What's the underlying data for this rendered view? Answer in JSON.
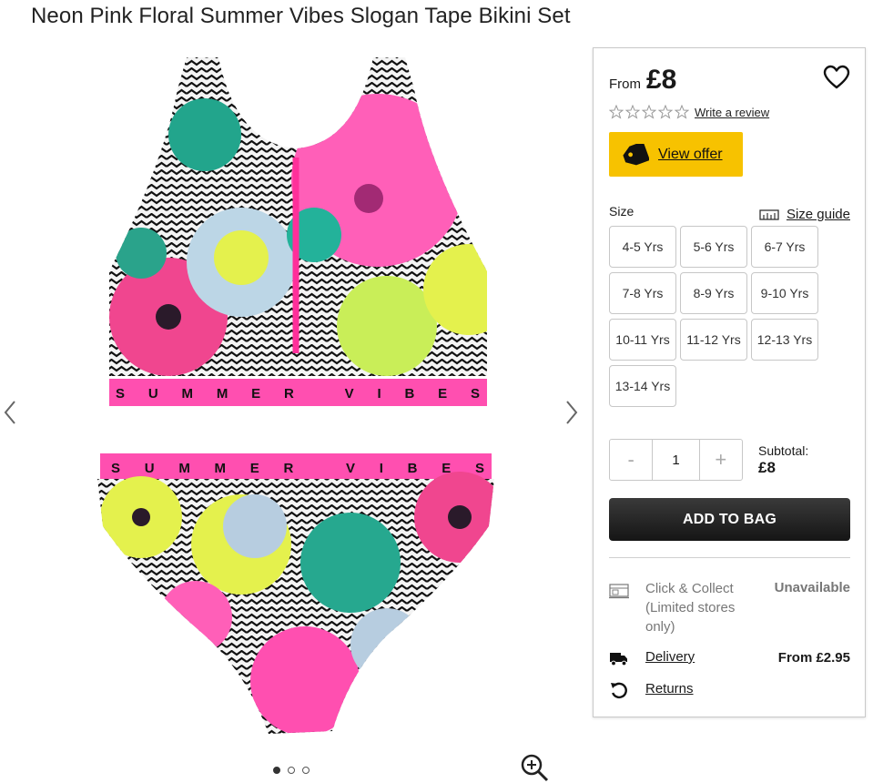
{
  "product": {
    "title": "Neon Pink Floral Summer Vibes Slogan Tape Bikini Set",
    "image_tape_text": "SUMMER VIBES"
  },
  "gallery": {
    "icons": {
      "prev": "chevron-left-icon",
      "next": "chevron-right-icon",
      "zoom": "zoom-in-icon"
    },
    "dots_count": 3,
    "active_dot": 1
  },
  "pricing": {
    "from_label": "From",
    "price": "£8"
  },
  "reviews": {
    "stars_total": 5,
    "rating": 0,
    "write_review": "Write a review"
  },
  "offer": {
    "label": "View offer",
    "color": "#f7c200"
  },
  "size": {
    "label": "Size",
    "guide_label": "Size guide",
    "options": [
      "4-5 Yrs",
      "5-6 Yrs",
      "6-7 Yrs",
      "7-8 Yrs",
      "8-9 Yrs",
      "9-10 Yrs",
      "10-11 Yrs",
      "11-12 Yrs",
      "12-13 Yrs",
      "13-14 Yrs"
    ]
  },
  "quantity": {
    "minus": "-",
    "value": "1",
    "plus": "+"
  },
  "subtotal": {
    "label": "Subtotal:",
    "amount": "£8"
  },
  "cta": {
    "add_to_bag": "ADD TO BAG"
  },
  "fulfilment": {
    "click_collect_label": "Click & Collect",
    "click_collect_note": "(Limited stores only)",
    "click_collect_status": "Unavailable",
    "delivery_label": "Delivery",
    "delivery_price": "From £2.95",
    "returns_label": "Returns"
  }
}
